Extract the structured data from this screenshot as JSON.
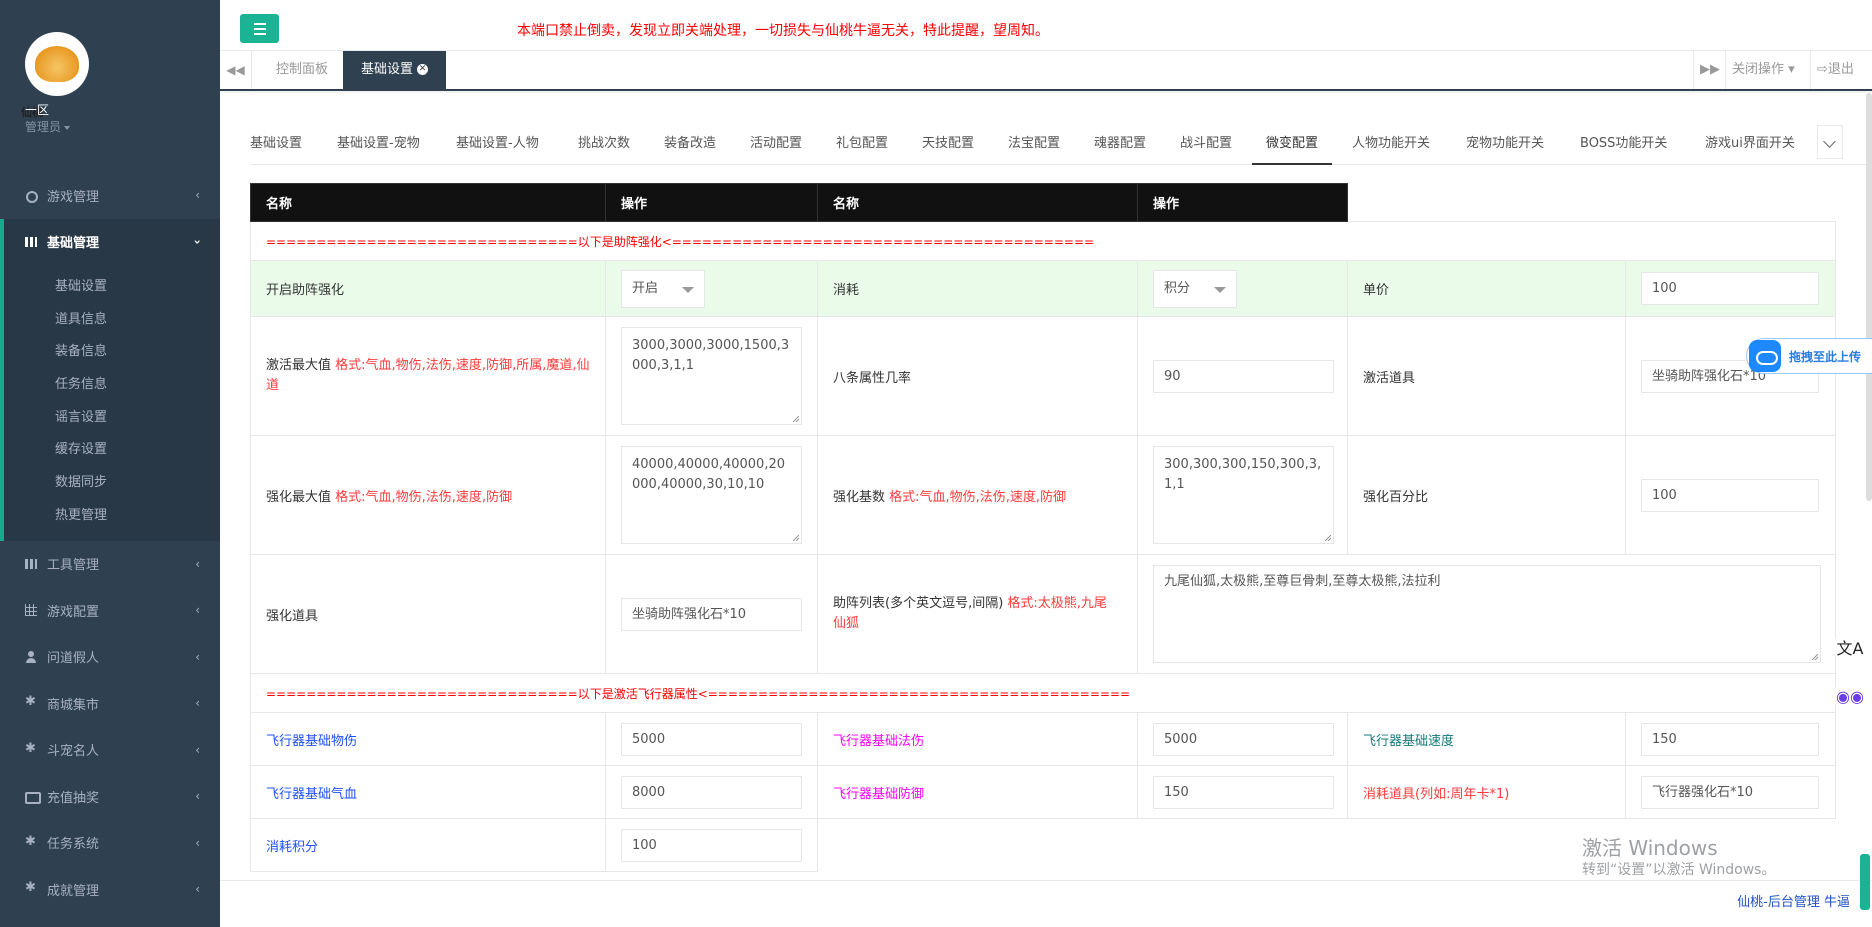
{
  "sidebar": {
    "logo_seal": "仙桃",
    "zone": "一区",
    "role": "管理员",
    "menu": [
      {
        "label": "游戏管理",
        "arrow": "‹"
      },
      {
        "label": "基础管理",
        "arrow": "›"
      },
      {
        "label": "工具管理",
        "arrow": "‹"
      },
      {
        "label": "游戏配置",
        "arrow": "‹"
      },
      {
        "label": "问道假人",
        "arrow": "‹"
      },
      {
        "label": "商城集市",
        "arrow": "‹"
      },
      {
        "label": "斗宠名人",
        "arrow": "‹"
      },
      {
        "label": "充值抽奖",
        "arrow": "‹"
      },
      {
        "label": "任务系统",
        "arrow": "‹"
      },
      {
        "label": "成就管理",
        "arrow": "‹"
      }
    ],
    "submenu": [
      "基础设置",
      "道具信息",
      "装备信息",
      "任务信息",
      "谣言设置",
      "缓存设置",
      "数据同步",
      "热更管理"
    ]
  },
  "topbar": {
    "notice": "本端口禁止倒卖，发现立即关端处理，一切损失与仙桃牛逼无关，特此提醒，望周知。"
  },
  "page_tabs": {
    "tab1": "控制面板",
    "tab2": "基础设置",
    "close_ops": "关闭操作",
    "logout": "退出"
  },
  "sub_tabs": [
    "基础设置",
    "基础设置-宠物",
    "基础设置-人物",
    "挑战次数",
    "装备改造",
    "活动配置",
    "礼包配置",
    "天技配置",
    "法宝配置",
    "魂器配置",
    "战斗配置",
    "微变配置",
    "人物功能开关",
    "宠物功能开关",
    "BOSS功能开关",
    "游戏ui界面开关"
  ],
  "table": {
    "headers": [
      "名称",
      "操作",
      "名称",
      "操作"
    ],
    "sep1": "===============================以下是助阵强化<==========================================",
    "r1": {
      "l1": "开启助阵强化",
      "sel1": "开启",
      "l2": "消耗",
      "sel2": "积分",
      "l3": "单价",
      "v3": "100"
    },
    "r2": {
      "l1": "激活最大值",
      "h1": "格式:气血,物伤,法伤,速度,防御,所属,魔道,仙道",
      "v1": "3000,3000,3000,1500,3000,3,1,1",
      "l2": "八条属性几率",
      "v2": "90",
      "l3": "激活道具",
      "v3": "坐骑助阵强化石*10"
    },
    "r3": {
      "l1": "强化最大值",
      "h1": "格式:气血,物伤,法伤,速度,防御",
      "v1": "40000,40000,40000,20000,40000,30,10,10",
      "l2": "强化基数",
      "h2": "格式:气血,物伤,法伤,速度,防御",
      "v2": "300,300,300,150,300,3,1,1",
      "l3": "强化百分比",
      "v3": "100"
    },
    "r4": {
      "l1": "强化道具",
      "v1": "坐骑助阵强化石*10",
      "l2": "助阵列表(多个英文逗号,间隔)",
      "h2": "格式:太极熊,九尾仙狐",
      "v2": "九尾仙狐,太极熊,至尊巨骨刺,至尊太极熊,法拉利"
    },
    "sep2": "===============================以下是激活飞行器属性<==========================================",
    "r5": {
      "l1": "飞行器基础物伤",
      "v1": "5000",
      "l2": "飞行器基础法伤",
      "v2": "5000",
      "l3": "飞行器基础速度",
      "v3": "150"
    },
    "r6": {
      "l1": "飞行器基础气血",
      "v1": "8000",
      "l2": "飞行器基础防御",
      "v2": "150",
      "l3": "消耗道具(列如:周年卡*1)",
      "v3": "飞行器强化石*10"
    },
    "r7": {
      "l1": "消耗积分",
      "v1": "100"
    }
  },
  "footer": {
    "text": "仙桃-后台管理 牛逼"
  },
  "overlay": {
    "upload": "拖拽至此上传",
    "win1": "激活 Windows",
    "win2": "转到“设置”以激活 Windows。"
  }
}
